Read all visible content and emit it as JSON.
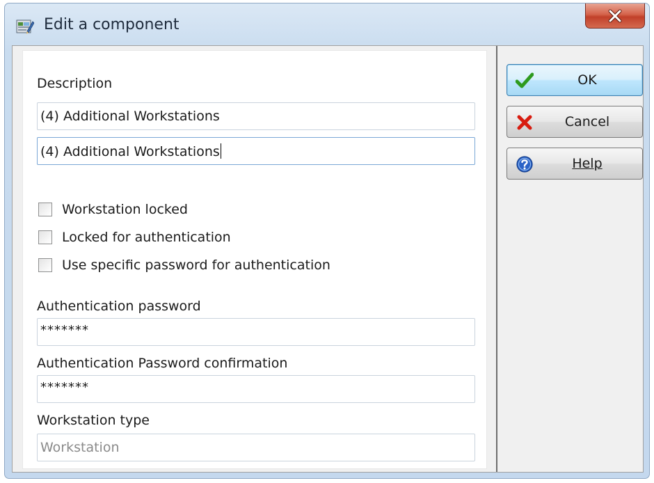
{
  "window": {
    "title": "Edit a component"
  },
  "form": {
    "description_label": "Description",
    "description_1": "(4)  Additional Workstations",
    "description_2": "(4)  Additional Workstations",
    "checkboxes": [
      {
        "label": "Workstation locked",
        "checked": false
      },
      {
        "label": "Locked for authentication",
        "checked": false
      },
      {
        "label": "Use specific password for authentication",
        "checked": false
      }
    ],
    "auth_password_label": "Authentication password",
    "auth_password_value": "*******",
    "auth_confirm_label": "Authentication Password confirmation",
    "auth_confirm_value": "*******",
    "workstation_type_label": "Workstation type",
    "workstation_type_placeholder": "Workstation"
  },
  "buttons": {
    "ok": {
      "label": "OK",
      "icon": "checkmark-icon"
    },
    "cancel": {
      "label": "Cancel",
      "icon": "x-cross-icon"
    },
    "help": {
      "label": "Help",
      "icon": "help-question-icon"
    }
  },
  "colors": {
    "ok_check": "#2e9a1e",
    "cancel_x": "#d81c10",
    "help_blue": "#2b63c7",
    "close_button": "#c9533b"
  }
}
